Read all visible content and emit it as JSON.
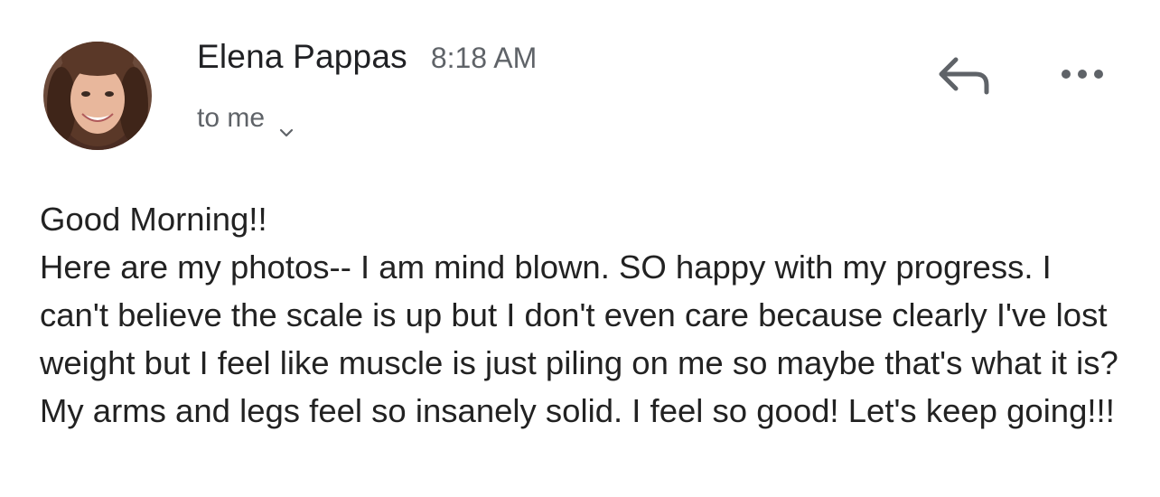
{
  "sender": {
    "name": "Elena Pappas",
    "time": "8:18 AM",
    "recipient": "to me"
  },
  "icons": {
    "avatar": "avatar-photo",
    "reply": "reply-arrow-icon",
    "more": "more-horizontal-icon",
    "recipient_toggle": "chevron-down-icon"
  },
  "colors": {
    "sender_name": "#202124",
    "meta_text": "#5f6368",
    "body_text": "#222222",
    "icon": "#5f6368"
  },
  "message": {
    "greeting": "Good Morning!!",
    "body": "Here are my photos-- I am mind blown. SO happy with my progress. I can't believe the scale is up but I don't even care because clearly I've lost weight but I feel like muscle is just piling on me so maybe that's what it is? My arms and legs feel so insanely solid. I feel so good! Let's keep going!!!"
  }
}
